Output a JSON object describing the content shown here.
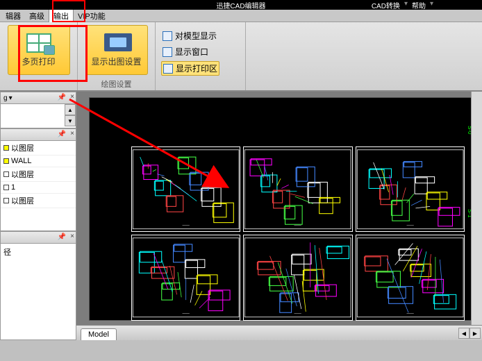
{
  "topbar": {
    "title": "迅捷CAD编辑器",
    "right1": "CAD转换",
    "right2": "帮助"
  },
  "menu": {
    "m0": "辑器",
    "m1": "高级",
    "m2": "输出",
    "m3": "VIP功能"
  },
  "ribbon": {
    "btn_multi_print": "多页打印",
    "btn_plot_settings": "显示出图设置",
    "opt_show_model": "对模型显示",
    "opt_show_window": "显示窗口",
    "opt_show_print_area": "显示打印区",
    "group_label": "绘图设置"
  },
  "panels": {
    "p1_tab": "g",
    "layers": [
      {
        "swatch": "#ffff00",
        "name": "以图层"
      },
      {
        "swatch": "#ffff00",
        "name": "WALL"
      },
      {
        "swatch": "#ffffff",
        "name": "以图层"
      },
      {
        "swatch": "#ffffff",
        "name": "1"
      },
      {
        "swatch": "#ffffff",
        "name": "以图层"
      }
    ],
    "p3_text": "径"
  },
  "tab": {
    "model": "Model"
  }
}
